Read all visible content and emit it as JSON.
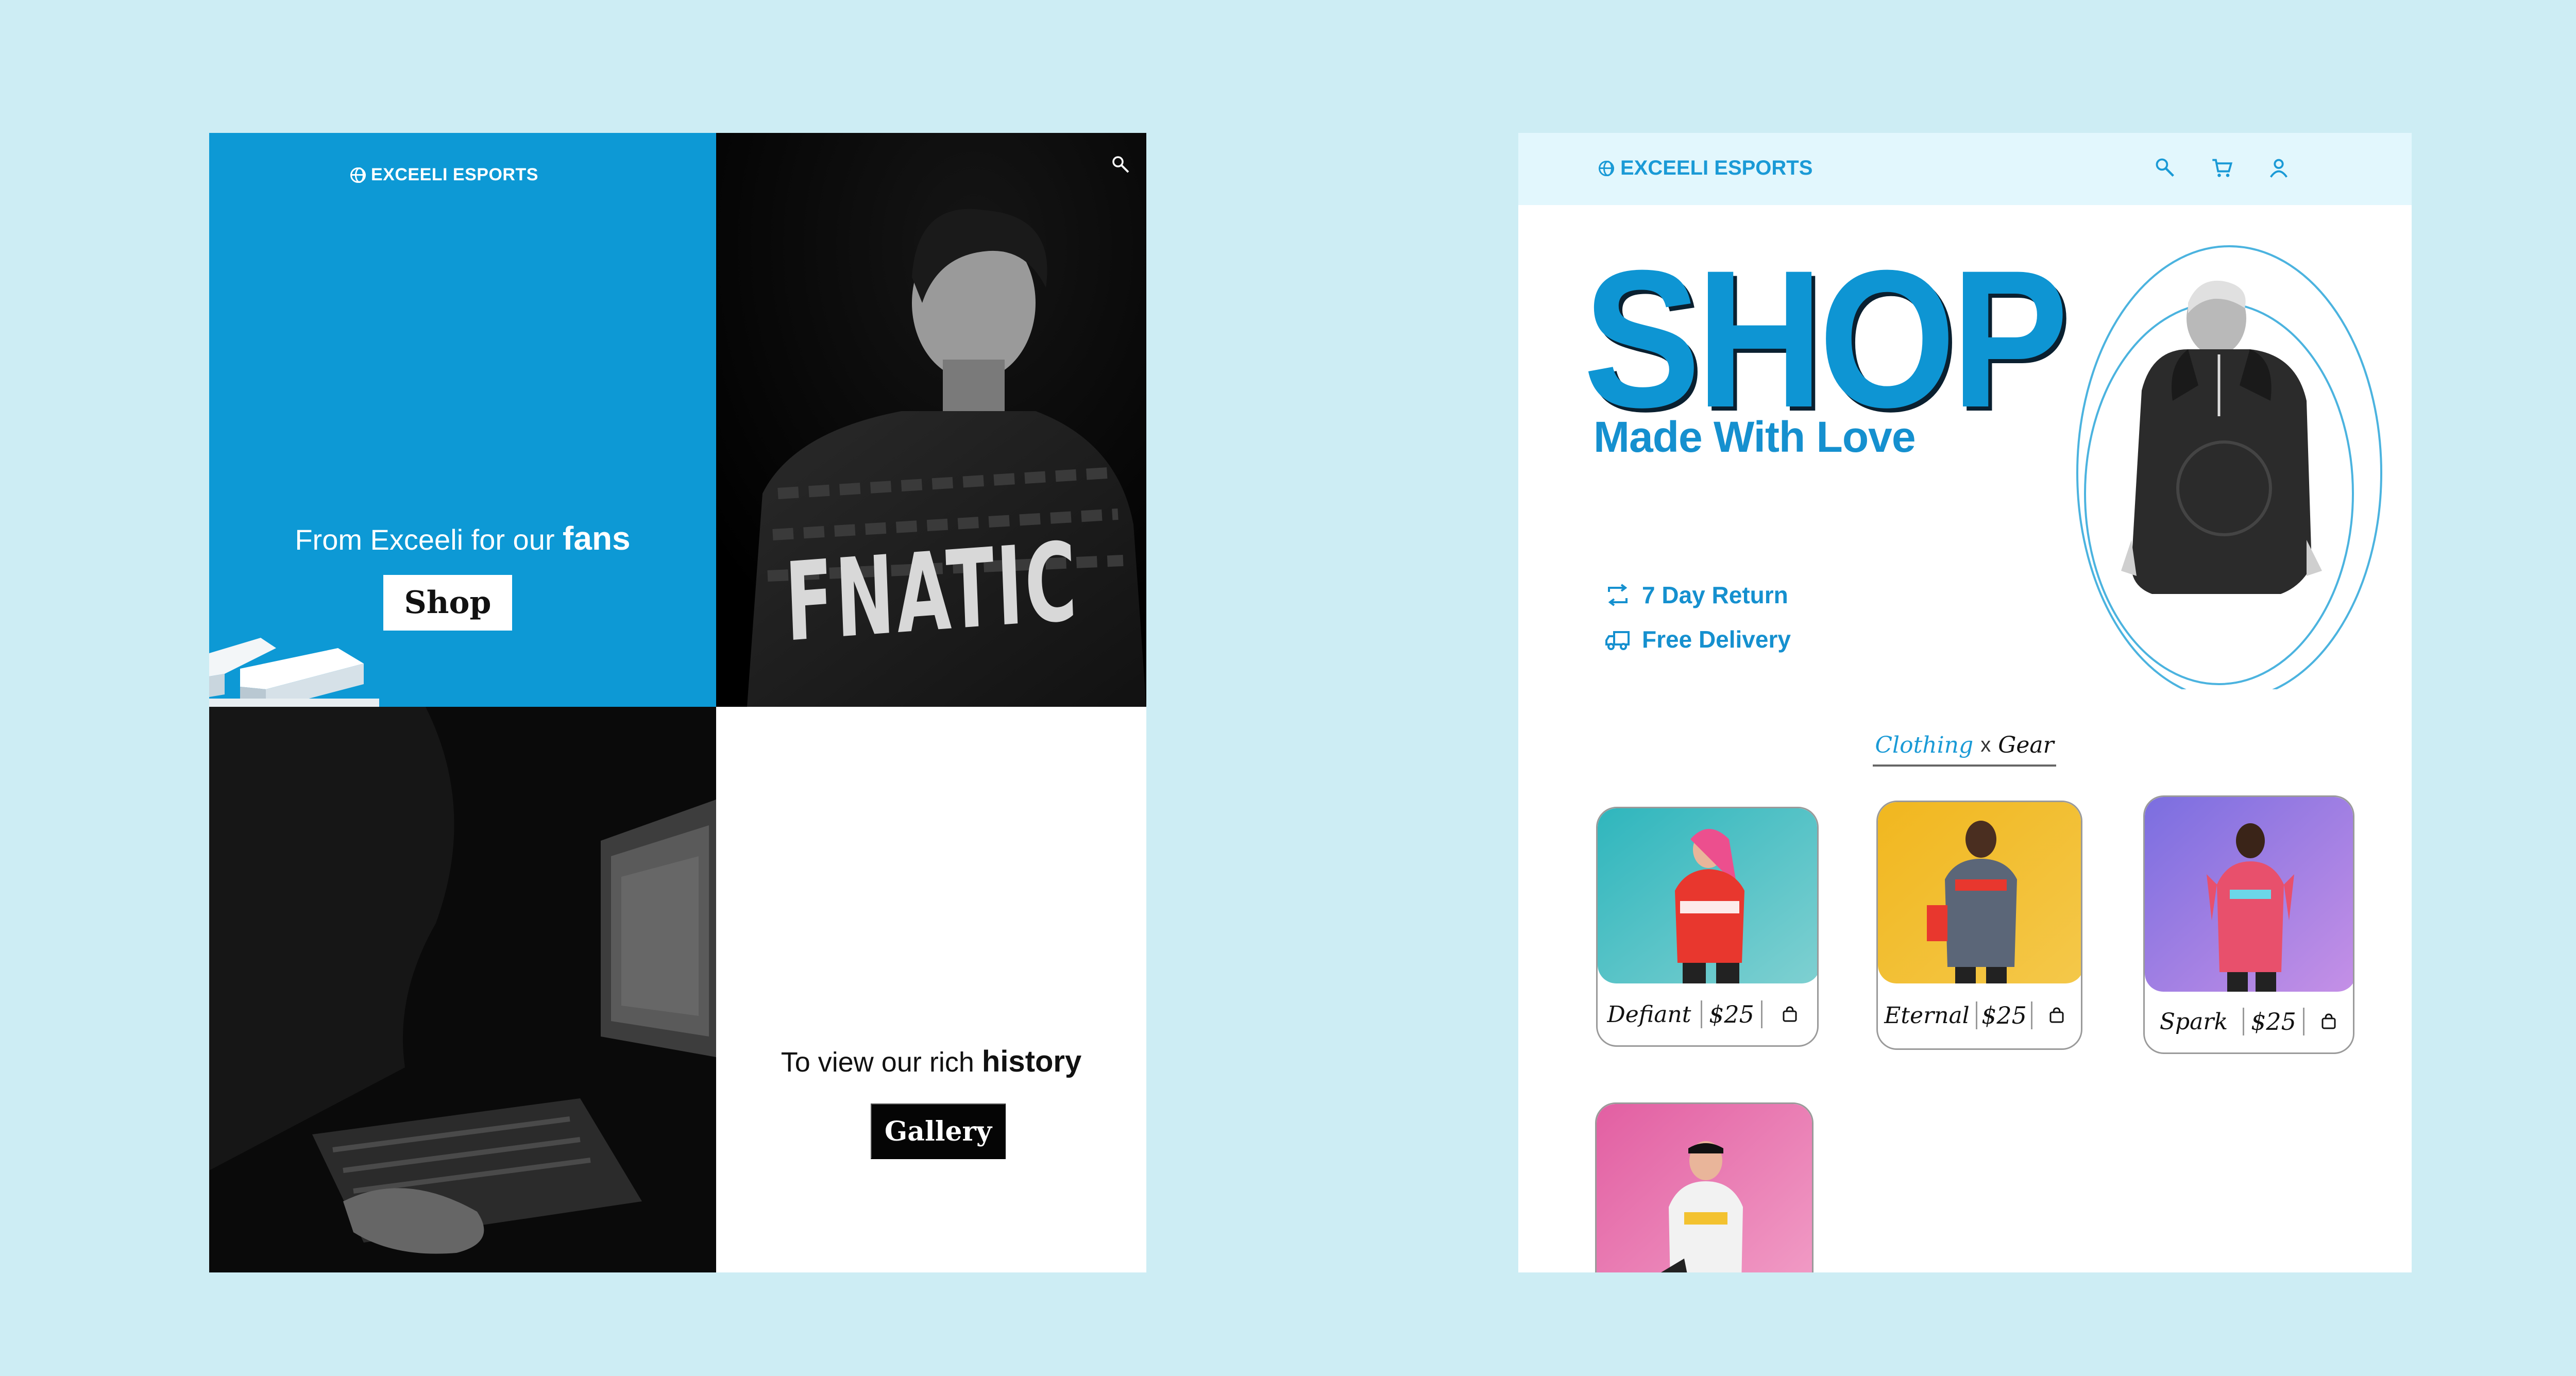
{
  "left_mockup": {
    "brand": "EXCEELI ESPORTS",
    "hero": {
      "tagline_prefix": "From Exceeli for our",
      "tagline_emphasis": "fans",
      "shop_button": "Shop"
    },
    "jersey_text": "FNATIC",
    "history": {
      "tagline_prefix": "To view our rich",
      "tagline_emphasis": "history",
      "gallery_button": "Gallery"
    },
    "nav_icons": [
      "search-icon",
      "cart-icon",
      "user-icon"
    ]
  },
  "right_mockup": {
    "brand": "EXCEELI ESPORTS",
    "nav_icons": [
      "search-icon",
      "cart-icon",
      "user-icon"
    ],
    "hero": {
      "title": "SHOP",
      "subtitle": "Made With Love"
    },
    "perks": [
      {
        "icon": "return-icon",
        "label": "7 Day Return"
      },
      {
        "icon": "delivery-truck-icon",
        "label": "Free Delivery"
      }
    ],
    "category_tabs": {
      "clothing": "Clothing",
      "separator": "x",
      "gear": "Gear"
    },
    "products": [
      {
        "name": "Defiant",
        "price": "$25",
        "colors": {
          "bg_from": "#2fb6bd",
          "bg_to": "#7fd0d1",
          "shirt": "#e8372e"
        }
      },
      {
        "name": "Eternal",
        "price": "$25",
        "colors": {
          "bg_from": "#f1b71f",
          "bg_to": "#f4c84a",
          "shirt": "#5b6678"
        }
      },
      {
        "name": "Spark",
        "price": "$25",
        "colors": {
          "bg_from": "#7b6ee0",
          "bg_to": "#c590e6",
          "shirt": "#e8506c"
        }
      },
      {
        "name": "",
        "price": "",
        "colors": {
          "bg_from": "#e25fa2",
          "bg_to": "#f2a0c8",
          "shirt": "#f2f2f2"
        }
      }
    ]
  },
  "colors": {
    "page_background": "#cdedf4",
    "accent_blue": "#0e95d3",
    "header_tint": "#e2f7fd"
  }
}
